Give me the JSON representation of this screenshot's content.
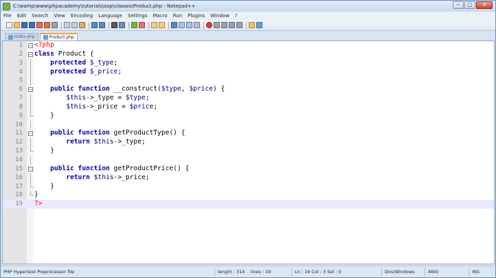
{
  "window": {
    "title": "C:\\wamp\\www\\phpacademy\\tutorials\\oop\\classes\\Product.php - Notepad++",
    "minimize_label": "─",
    "maximize_label": "□",
    "close_label": "✕"
  },
  "menu": [
    "File",
    "Edit",
    "Search",
    "View",
    "Encoding",
    "Language",
    "Settings",
    "Macro",
    "Run",
    "Plugins",
    "Window",
    "?"
  ],
  "tabs": [
    {
      "label": "index.php",
      "active": false
    },
    {
      "label": "Product.php",
      "active": true
    }
  ],
  "editor": {
    "current_line": 19,
    "lines": [
      {
        "n": "1",
        "code": "<?php"
      },
      {
        "n": "2",
        "code": "class Product {"
      },
      {
        "n": "3",
        "code": "    protected $_type;"
      },
      {
        "n": "4",
        "code": "    protected $_price;"
      },
      {
        "n": "5",
        "code": ""
      },
      {
        "n": "6",
        "code": "    public function __construct($type, $price) {"
      },
      {
        "n": "7",
        "code": "        $this->_type = $type;"
      },
      {
        "n": "8",
        "code": "        $this->_price = $price;"
      },
      {
        "n": "9",
        "code": "    }"
      },
      {
        "n": "10",
        "code": ""
      },
      {
        "n": "11",
        "code": "    public function getProductType() {"
      },
      {
        "n": "12",
        "code": "        return $this->_type;"
      },
      {
        "n": "13",
        "code": "    }"
      },
      {
        "n": "14",
        "code": ""
      },
      {
        "n": "15",
        "code": "    public function getProductPrice() {"
      },
      {
        "n": "16",
        "code": "        return $this->_price;"
      },
      {
        "n": "17",
        "code": "    }"
      },
      {
        "n": "18",
        "code": "}"
      },
      {
        "n": "19",
        "code": "?>"
      }
    ]
  },
  "status": {
    "file_type": "PHP Hypertext Preprocessor file",
    "length": "length : 314",
    "lines": "lines : 19",
    "position": "Ln : 19    Col : 3    Sel : 0",
    "eol": "Dos\\Windows",
    "encoding": "ANSI",
    "mode": "INS"
  },
  "colors": {
    "keyword": "#0000a0",
    "php_tag": "#ff0000",
    "current_line": "#e8e8ff",
    "active_tab_accent": "#f3a43a"
  }
}
